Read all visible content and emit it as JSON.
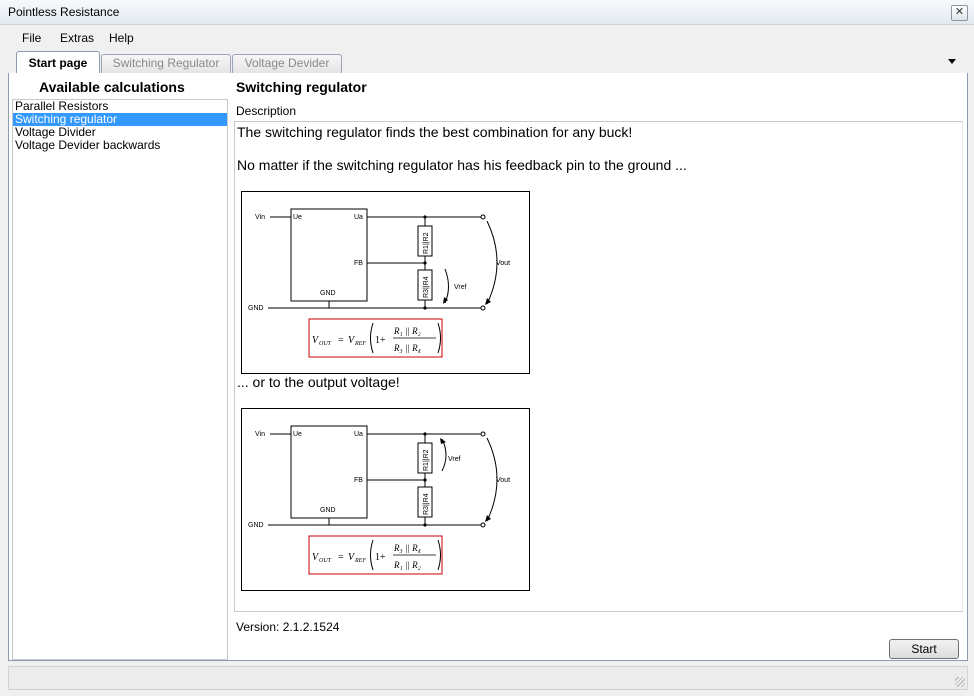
{
  "window": {
    "title": "Pointless Resistance",
    "close_glyph": "✕"
  },
  "menu": {
    "file": "File",
    "extras": "Extras",
    "help": "Help"
  },
  "tabs": [
    {
      "label": "Start page",
      "active": true
    },
    {
      "label": "Switching Regulator",
      "active": false
    },
    {
      "label": "Voltage Devider",
      "active": false
    }
  ],
  "sidebar": {
    "heading": "Available calculations",
    "items": [
      {
        "label": "Parallel Resistors",
        "selected": false
      },
      {
        "label": "Switching regulator",
        "selected": true
      },
      {
        "label": "Voltage Divider",
        "selected": false
      },
      {
        "label": "Voltage Devider backwards",
        "selected": false
      }
    ]
  },
  "content": {
    "heading": "Switching regulator",
    "description_label": "Description",
    "para1": "The switching regulator finds the best combination for any buck!",
    "para2": "No matter if the switching regulator has his feedback pin to the ground ...",
    "para3": "... or to the output voltage!",
    "circuit": {
      "vin": "Vin",
      "gnd": "GND",
      "ue": "Ue",
      "ua": "Ua",
      "fb": "FB",
      "gnd_pin": "GND",
      "vout": "Vout",
      "vref": "Vref",
      "r12": "R1||R2",
      "r34": "R3||R4",
      "formula1": {
        "lhs": "V",
        "lhs_sub": "OUT",
        "eq": "=",
        "vref": "V",
        "vref_sub": "REF",
        "one": "1+",
        "num": "R₁ || R₂",
        "den": "R₃ || R₄"
      },
      "formula2": {
        "lhs": "V",
        "lhs_sub": "OUT",
        "eq": "=",
        "vref": "V",
        "vref_sub": "REF",
        "one": "1+",
        "num": "R₃ || R₄",
        "den": "R₁ || R₂"
      }
    },
    "version": "Version: 2.1.2.1524",
    "start_button": "Start"
  },
  "colors": {
    "selection": "#3399ff",
    "formula_border": "#cc0000"
  }
}
